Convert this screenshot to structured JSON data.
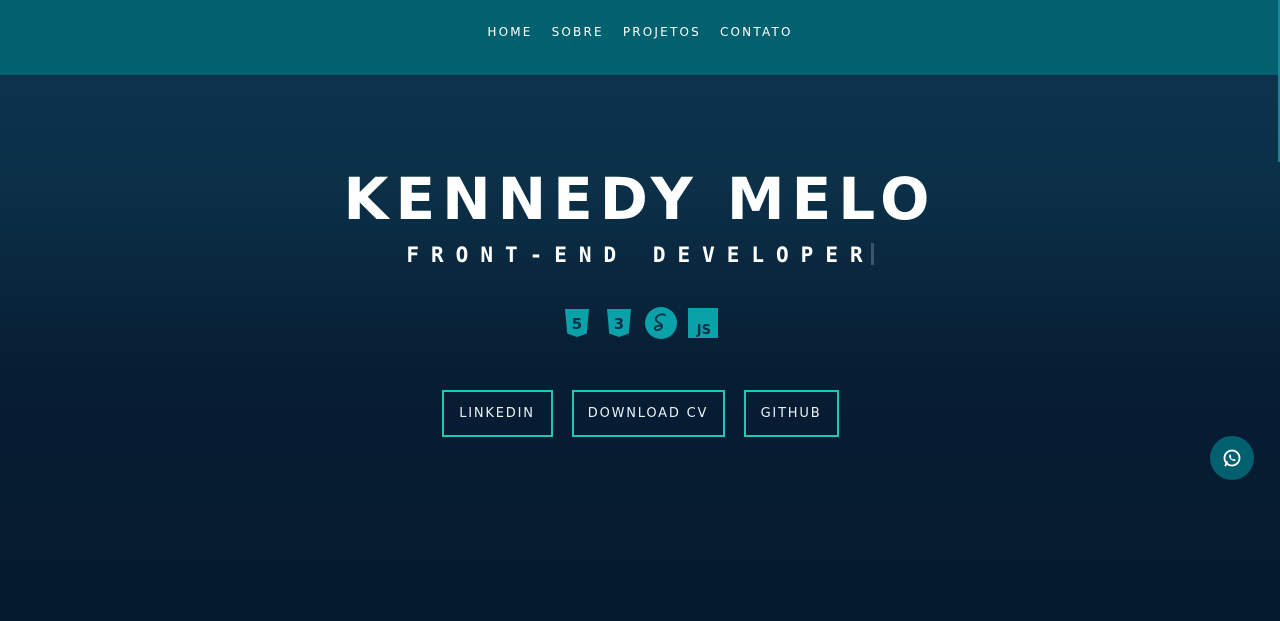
{
  "nav": {
    "items": [
      {
        "label": "HOME"
      },
      {
        "label": "SOBRE"
      },
      {
        "label": "PROJETOS"
      },
      {
        "label": "CONTATO"
      }
    ]
  },
  "hero": {
    "name": "KENNEDY MELO",
    "role": "FRONT-END DEVELOPER",
    "tech_icons": [
      "html5-icon",
      "css3-icon",
      "sass-icon",
      "javascript-icon"
    ],
    "tech_labels": {
      "html": "5",
      "css": "3",
      "js": "JS"
    }
  },
  "buttons": {
    "linkedin": "LINKEDIN",
    "download_cv": "DOWNLOAD CV",
    "github": "GITHUB"
  },
  "colors": {
    "topbar": "#03606f",
    "accent_border": "#1fc7b4",
    "icon_teal": "#0aa1a8",
    "background_top": "#0c3450",
    "background_bottom": "#061a2e"
  },
  "floating": {
    "icon": "whatsapp-icon"
  }
}
